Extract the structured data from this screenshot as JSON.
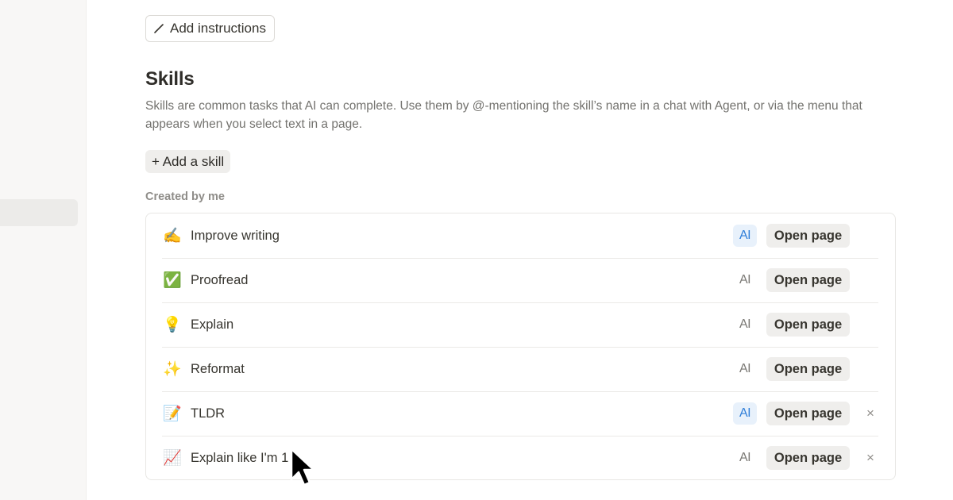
{
  "toolbar": {
    "add_instructions_label": "Add instructions"
  },
  "skills": {
    "title": "Skills",
    "description": "Skills are common tasks that AI can complete. Use them by @-mentioning the skill’s name in a chat with Agent, or via the menu that appears when you select text in a page.",
    "add_skill_label": "+ Add a skill",
    "group_label": "Created by me",
    "ai_label": "AI",
    "open_page_label": "Open page",
    "remove_label": "×",
    "items": [
      {
        "emoji": "✍️",
        "icon": "writing-hand-icon",
        "name": "Improve writing",
        "ai_active": true,
        "removable": false
      },
      {
        "emoji": "✅",
        "icon": "check-mark-icon",
        "name": "Proofread",
        "ai_active": false,
        "removable": false
      },
      {
        "emoji": "💡",
        "icon": "light-bulb-icon",
        "name": "Explain",
        "ai_active": false,
        "removable": false
      },
      {
        "emoji": "✨",
        "icon": "sparkles-icon",
        "name": "Reformat",
        "ai_active": false,
        "removable": false
      },
      {
        "emoji": "📝",
        "icon": "memo-icon",
        "name": "TLDR",
        "ai_active": true,
        "removable": true
      },
      {
        "emoji": "📈",
        "icon": "chart-increasing-icon",
        "name": "Explain like I'm 1",
        "ai_active": false,
        "removable": true
      }
    ]
  },
  "colors": {
    "ai_active": "#2f7ed8",
    "ai_active_bg": "#e8f1fb",
    "button_bg": "#efeeec",
    "sidebar_bg": "#f8f7f6"
  }
}
